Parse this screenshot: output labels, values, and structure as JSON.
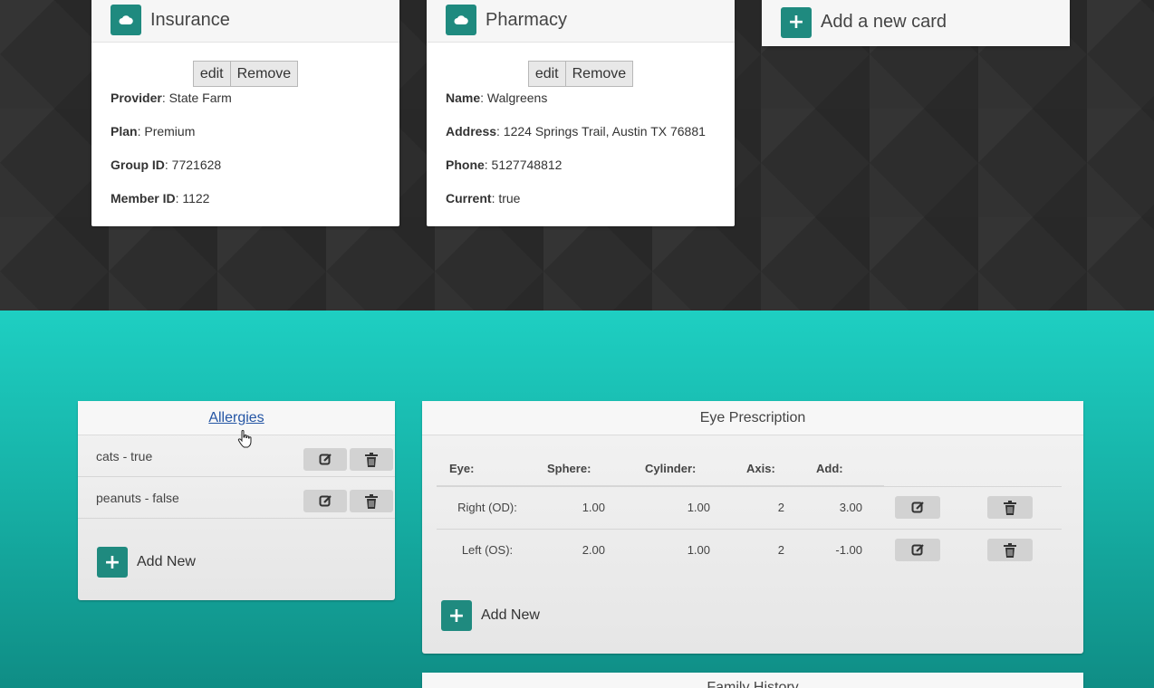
{
  "cards": {
    "insurance": {
      "title": "Insurance",
      "icon": "cloud-icon",
      "edit_label": "edit",
      "remove_label": "Remove",
      "fields": [
        {
          "label": "Provider",
          "value": ": State Farm"
        },
        {
          "label": "Plan",
          "value": ": Premium"
        },
        {
          "label": "Group ID",
          "value": ": 7721628"
        },
        {
          "label": "Member ID",
          "value": ": 1122"
        }
      ]
    },
    "pharmacy": {
      "title": "Pharmacy",
      "icon": "cloud-icon",
      "edit_label": "edit",
      "remove_label": "Remove",
      "fields": [
        {
          "label": "Name",
          "value": ": Walgreens"
        },
        {
          "label": "Address",
          "value": ": 1224 Springs Trail, Austin TX 76881"
        },
        {
          "label": "Phone",
          "value": ": 5127748812"
        },
        {
          "label": "Current",
          "value": ": true"
        }
      ]
    },
    "add_card": {
      "label": "Add a new card",
      "icon": "plus-icon"
    }
  },
  "allergies": {
    "title": "Allergies",
    "items": [
      "cats - true",
      "peanuts - false"
    ],
    "add_label": "Add New"
  },
  "eye_prescription": {
    "title": "Eye Prescription",
    "headers": [
      "Eye:",
      "Sphere:",
      "Cylinder:",
      "Axis:",
      "Add:"
    ],
    "rows": [
      {
        "eye": "Right (OD):",
        "sphere": "1.00",
        "cylinder": "1.00",
        "axis": "2",
        "add": "3.00"
      },
      {
        "eye": "Left (OS):",
        "sphere": "2.00",
        "cylinder": "1.00",
        "axis": "2",
        "add": "-1.00"
      }
    ],
    "add_label": "Add New"
  },
  "family_history": {
    "title": "Family History"
  },
  "colors": {
    "accent": "#1f8a7f",
    "teal_bg": "#1ecfc2",
    "dark_bg": "#2d2d2d",
    "link": "#2455a4"
  }
}
